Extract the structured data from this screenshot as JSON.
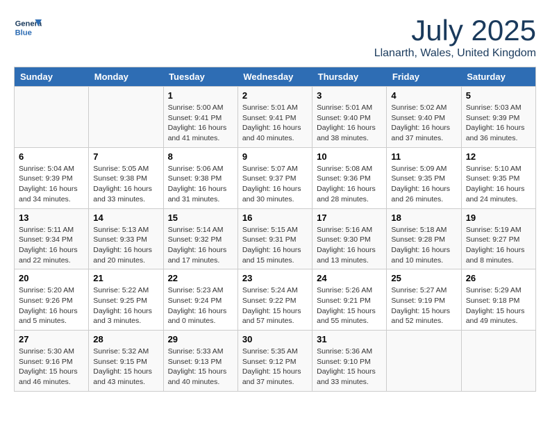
{
  "header": {
    "logo_line1": "General",
    "logo_line2": "Blue",
    "month_year": "July 2025",
    "location": "Llanarth, Wales, United Kingdom"
  },
  "weekdays": [
    "Sunday",
    "Monday",
    "Tuesday",
    "Wednesday",
    "Thursday",
    "Friday",
    "Saturday"
  ],
  "weeks": [
    [
      {
        "day": "",
        "info": ""
      },
      {
        "day": "",
        "info": ""
      },
      {
        "day": "1",
        "info": "Sunrise: 5:00 AM\nSunset: 9:41 PM\nDaylight: 16 hours\nand 41 minutes."
      },
      {
        "day": "2",
        "info": "Sunrise: 5:01 AM\nSunset: 9:41 PM\nDaylight: 16 hours\nand 40 minutes."
      },
      {
        "day": "3",
        "info": "Sunrise: 5:01 AM\nSunset: 9:40 PM\nDaylight: 16 hours\nand 38 minutes."
      },
      {
        "day": "4",
        "info": "Sunrise: 5:02 AM\nSunset: 9:40 PM\nDaylight: 16 hours\nand 37 minutes."
      },
      {
        "day": "5",
        "info": "Sunrise: 5:03 AM\nSunset: 9:39 PM\nDaylight: 16 hours\nand 36 minutes."
      }
    ],
    [
      {
        "day": "6",
        "info": "Sunrise: 5:04 AM\nSunset: 9:39 PM\nDaylight: 16 hours\nand 34 minutes."
      },
      {
        "day": "7",
        "info": "Sunrise: 5:05 AM\nSunset: 9:38 PM\nDaylight: 16 hours\nand 33 minutes."
      },
      {
        "day": "8",
        "info": "Sunrise: 5:06 AM\nSunset: 9:38 PM\nDaylight: 16 hours\nand 31 minutes."
      },
      {
        "day": "9",
        "info": "Sunrise: 5:07 AM\nSunset: 9:37 PM\nDaylight: 16 hours\nand 30 minutes."
      },
      {
        "day": "10",
        "info": "Sunrise: 5:08 AM\nSunset: 9:36 PM\nDaylight: 16 hours\nand 28 minutes."
      },
      {
        "day": "11",
        "info": "Sunrise: 5:09 AM\nSunset: 9:35 PM\nDaylight: 16 hours\nand 26 minutes."
      },
      {
        "day": "12",
        "info": "Sunrise: 5:10 AM\nSunset: 9:35 PM\nDaylight: 16 hours\nand 24 minutes."
      }
    ],
    [
      {
        "day": "13",
        "info": "Sunrise: 5:11 AM\nSunset: 9:34 PM\nDaylight: 16 hours\nand 22 minutes."
      },
      {
        "day": "14",
        "info": "Sunrise: 5:13 AM\nSunset: 9:33 PM\nDaylight: 16 hours\nand 20 minutes."
      },
      {
        "day": "15",
        "info": "Sunrise: 5:14 AM\nSunset: 9:32 PM\nDaylight: 16 hours\nand 17 minutes."
      },
      {
        "day": "16",
        "info": "Sunrise: 5:15 AM\nSunset: 9:31 PM\nDaylight: 16 hours\nand 15 minutes."
      },
      {
        "day": "17",
        "info": "Sunrise: 5:16 AM\nSunset: 9:30 PM\nDaylight: 16 hours\nand 13 minutes."
      },
      {
        "day": "18",
        "info": "Sunrise: 5:18 AM\nSunset: 9:28 PM\nDaylight: 16 hours\nand 10 minutes."
      },
      {
        "day": "19",
        "info": "Sunrise: 5:19 AM\nSunset: 9:27 PM\nDaylight: 16 hours\nand 8 minutes."
      }
    ],
    [
      {
        "day": "20",
        "info": "Sunrise: 5:20 AM\nSunset: 9:26 PM\nDaylight: 16 hours\nand 5 minutes."
      },
      {
        "day": "21",
        "info": "Sunrise: 5:22 AM\nSunset: 9:25 PM\nDaylight: 16 hours\nand 3 minutes."
      },
      {
        "day": "22",
        "info": "Sunrise: 5:23 AM\nSunset: 9:24 PM\nDaylight: 16 hours\nand 0 minutes."
      },
      {
        "day": "23",
        "info": "Sunrise: 5:24 AM\nSunset: 9:22 PM\nDaylight: 15 hours\nand 57 minutes."
      },
      {
        "day": "24",
        "info": "Sunrise: 5:26 AM\nSunset: 9:21 PM\nDaylight: 15 hours\nand 55 minutes."
      },
      {
        "day": "25",
        "info": "Sunrise: 5:27 AM\nSunset: 9:19 PM\nDaylight: 15 hours\nand 52 minutes."
      },
      {
        "day": "26",
        "info": "Sunrise: 5:29 AM\nSunset: 9:18 PM\nDaylight: 15 hours\nand 49 minutes."
      }
    ],
    [
      {
        "day": "27",
        "info": "Sunrise: 5:30 AM\nSunset: 9:16 PM\nDaylight: 15 hours\nand 46 minutes."
      },
      {
        "day": "28",
        "info": "Sunrise: 5:32 AM\nSunset: 9:15 PM\nDaylight: 15 hours\nand 43 minutes."
      },
      {
        "day": "29",
        "info": "Sunrise: 5:33 AM\nSunset: 9:13 PM\nDaylight: 15 hours\nand 40 minutes."
      },
      {
        "day": "30",
        "info": "Sunrise: 5:35 AM\nSunset: 9:12 PM\nDaylight: 15 hours\nand 37 minutes."
      },
      {
        "day": "31",
        "info": "Sunrise: 5:36 AM\nSunset: 9:10 PM\nDaylight: 15 hours\nand 33 minutes."
      },
      {
        "day": "",
        "info": ""
      },
      {
        "day": "",
        "info": ""
      }
    ]
  ]
}
